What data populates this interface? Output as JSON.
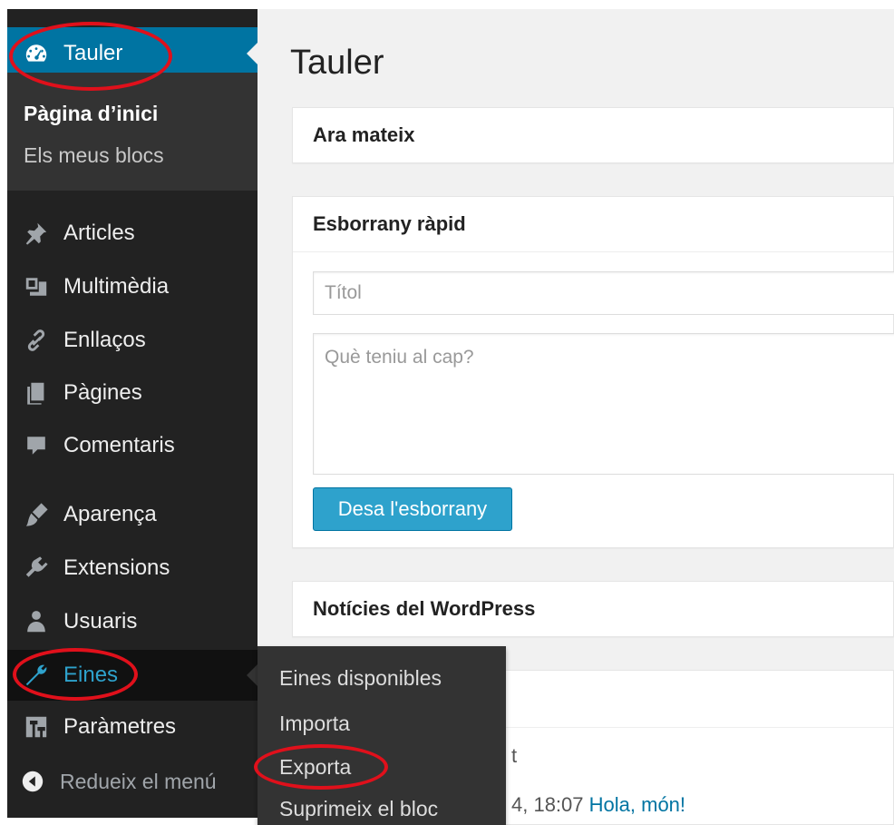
{
  "sidebar": {
    "dashboard_label": "Tauler",
    "dashboard_sub": {
      "home": "Pàgina d’inici",
      "my_blogs": "Els meus blocs"
    },
    "items": [
      {
        "label": "Articles",
        "icon": "pin-icon"
      },
      {
        "label": "Multimèdia",
        "icon": "media-icon"
      },
      {
        "label": "Enllaços",
        "icon": "link-icon"
      },
      {
        "label": "Pàgines",
        "icon": "pages-icon"
      },
      {
        "label": "Comentaris",
        "icon": "comment-icon"
      },
      {
        "label": "Aparença",
        "icon": "brush-icon"
      },
      {
        "label": "Extensions",
        "icon": "plugin-icon"
      },
      {
        "label": "Usuaris",
        "icon": "users-icon"
      },
      {
        "label": "Eines",
        "icon": "wrench-icon"
      },
      {
        "label": "Paràmetres",
        "icon": "settings-icon"
      }
    ],
    "collapse_label": "Redueix el menú",
    "tools_flyout": [
      "Eines disponibles",
      "Importa",
      "Exporta",
      "Suprimeix el bloc"
    ]
  },
  "main": {
    "page_title": "Tauler",
    "at_a_glance_title": "Ara mateix",
    "quick_draft": {
      "title": "Esborrany ràpid",
      "title_placeholder": "Títol",
      "content_placeholder": "Què teniu al cap?",
      "save_button": "Desa l'esborrany"
    },
    "news_title": "Notícies del WordPress",
    "activity": {
      "fragment": "t",
      "date_fragment": "4, 18:07",
      "post_link": "Hola, món!"
    }
  },
  "colors": {
    "sidebar_bg": "#222222",
    "active_bg": "#0074a2",
    "accent": "#2ea2cc",
    "annotation_red": "#e0101b"
  }
}
